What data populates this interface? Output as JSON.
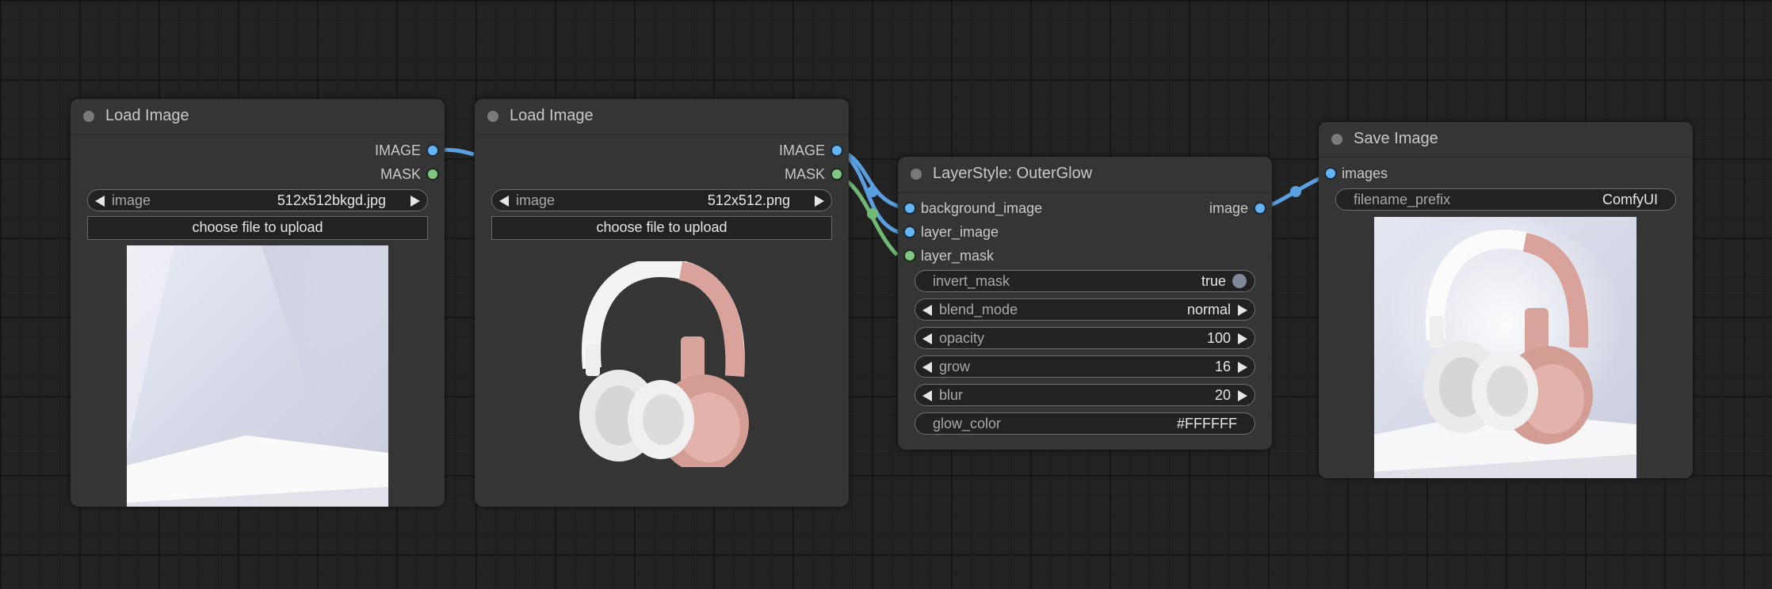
{
  "canvas": {
    "background": "#222222"
  },
  "nodes": {
    "load1": {
      "title": "Load Image",
      "outputs": {
        "image": "IMAGE",
        "mask": "MASK"
      },
      "image_widget": {
        "label": "image",
        "value": "512x512bkgd.jpg"
      },
      "upload_label": "choose file to upload"
    },
    "load2": {
      "title": "Load Image",
      "outputs": {
        "image": "IMAGE",
        "mask": "MASK"
      },
      "image_widget": {
        "label": "image",
        "value": "512x512.png"
      },
      "upload_label": "choose file to upload"
    },
    "glow": {
      "title": "LayerStyle: OuterGlow",
      "inputs": {
        "background_image": "background_image",
        "layer_image": "layer_image",
        "layer_mask": "layer_mask"
      },
      "output": "image",
      "widgets": {
        "invert_mask": {
          "label": "invert_mask",
          "value": "true"
        },
        "blend_mode": {
          "label": "blend_mode",
          "value": "normal"
        },
        "opacity": {
          "label": "opacity",
          "value": "100"
        },
        "grow": {
          "label": "grow",
          "value": "16"
        },
        "blur": {
          "label": "blur",
          "value": "20"
        },
        "glow_color": {
          "label": "glow_color",
          "value": "#FFFFFF"
        }
      }
    },
    "save": {
      "title": "Save Image",
      "input": "images",
      "filename_prefix": {
        "label": "filename_prefix",
        "value": "ComfyUI"
      }
    }
  },
  "colors": {
    "image_slot": "#64b5f6",
    "mask_slot": "#81c784",
    "node_bg": "#353535"
  }
}
